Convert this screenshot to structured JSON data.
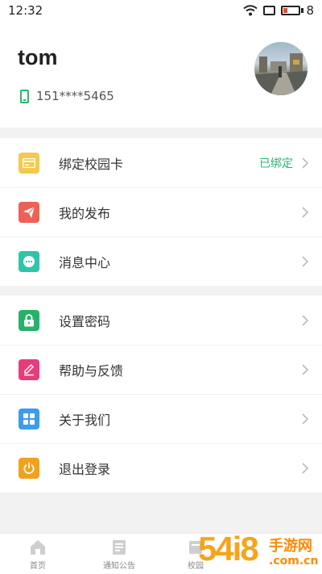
{
  "status_bar": {
    "time": "12:32",
    "battery_level": "8"
  },
  "profile": {
    "username": "tom",
    "phone": "151****5465"
  },
  "menu_group_1": [
    {
      "label": "绑定校园卡",
      "status": "已绑定",
      "icon": "card-icon",
      "color": "#f4c94f"
    },
    {
      "label": "我的发布",
      "status": "",
      "icon": "send-icon",
      "color": "#ec6256"
    },
    {
      "label": "消息中心",
      "status": "",
      "icon": "message-icon",
      "color": "#30c4a8"
    }
  ],
  "menu_group_2": [
    {
      "label": "设置密码",
      "icon": "lock-icon",
      "color": "#26b26b"
    },
    {
      "label": "帮助与反馈",
      "icon": "edit-icon",
      "color": "#e63c7d"
    },
    {
      "label": "关于我们",
      "icon": "grid-icon",
      "color": "#3c9cee"
    },
    {
      "label": "退出登录",
      "icon": "power-icon",
      "color": "#f0a21f"
    }
  ],
  "bottom_nav": [
    {
      "label": "首页",
      "icon": "home-icon"
    },
    {
      "label": "通知公告",
      "icon": "notice-icon"
    },
    {
      "label": "校园",
      "icon": "campus-icon"
    }
  ],
  "watermark": {
    "text": "54i8",
    "cn": "手游网",
    "url": ".com.cn"
  }
}
